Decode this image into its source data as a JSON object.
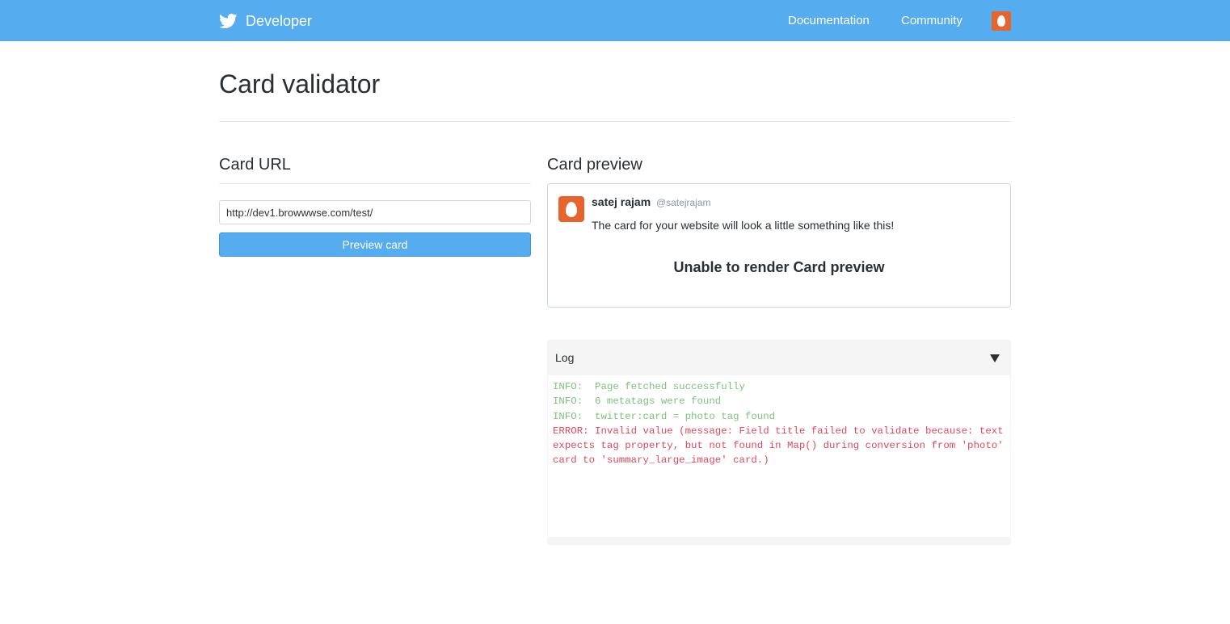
{
  "header": {
    "brand": "Developer",
    "nav": {
      "documentation": "Documentation",
      "community": "Community"
    }
  },
  "page": {
    "title": "Card validator"
  },
  "card_url": {
    "heading": "Card URL",
    "input_value": "http://dev1.browwwse.com/test/",
    "button_label": "Preview card"
  },
  "card_preview": {
    "heading": "Card preview",
    "tweet": {
      "name": "satej rajam",
      "handle": "@satejrajam",
      "text": "The card for your website will look a little something like this!"
    },
    "status": "Unable to render Card preview"
  },
  "log": {
    "title": "Log",
    "lines": [
      {
        "level": "info",
        "text": "INFO:  Page fetched successfully"
      },
      {
        "level": "info",
        "text": "INFO:  6 metatags were found"
      },
      {
        "level": "info",
        "text": "INFO:  twitter:card = photo tag found"
      },
      {
        "level": "error",
        "text": "ERROR: Invalid value (message: Field title failed to validate because: text expects tag property, but not found in Map() during conversion from 'photo' card to 'summary_large_image' card.)"
      }
    ]
  },
  "colors": {
    "brand_blue": "#55acee",
    "avatar_orange": "#e8642d",
    "log_info": "#7ec27e",
    "log_error": "#e0485f"
  },
  "icons": {
    "brand": "twitter-bird-icon",
    "avatar": "egg-avatar-icon",
    "log_toggle": "caret-down-icon"
  }
}
